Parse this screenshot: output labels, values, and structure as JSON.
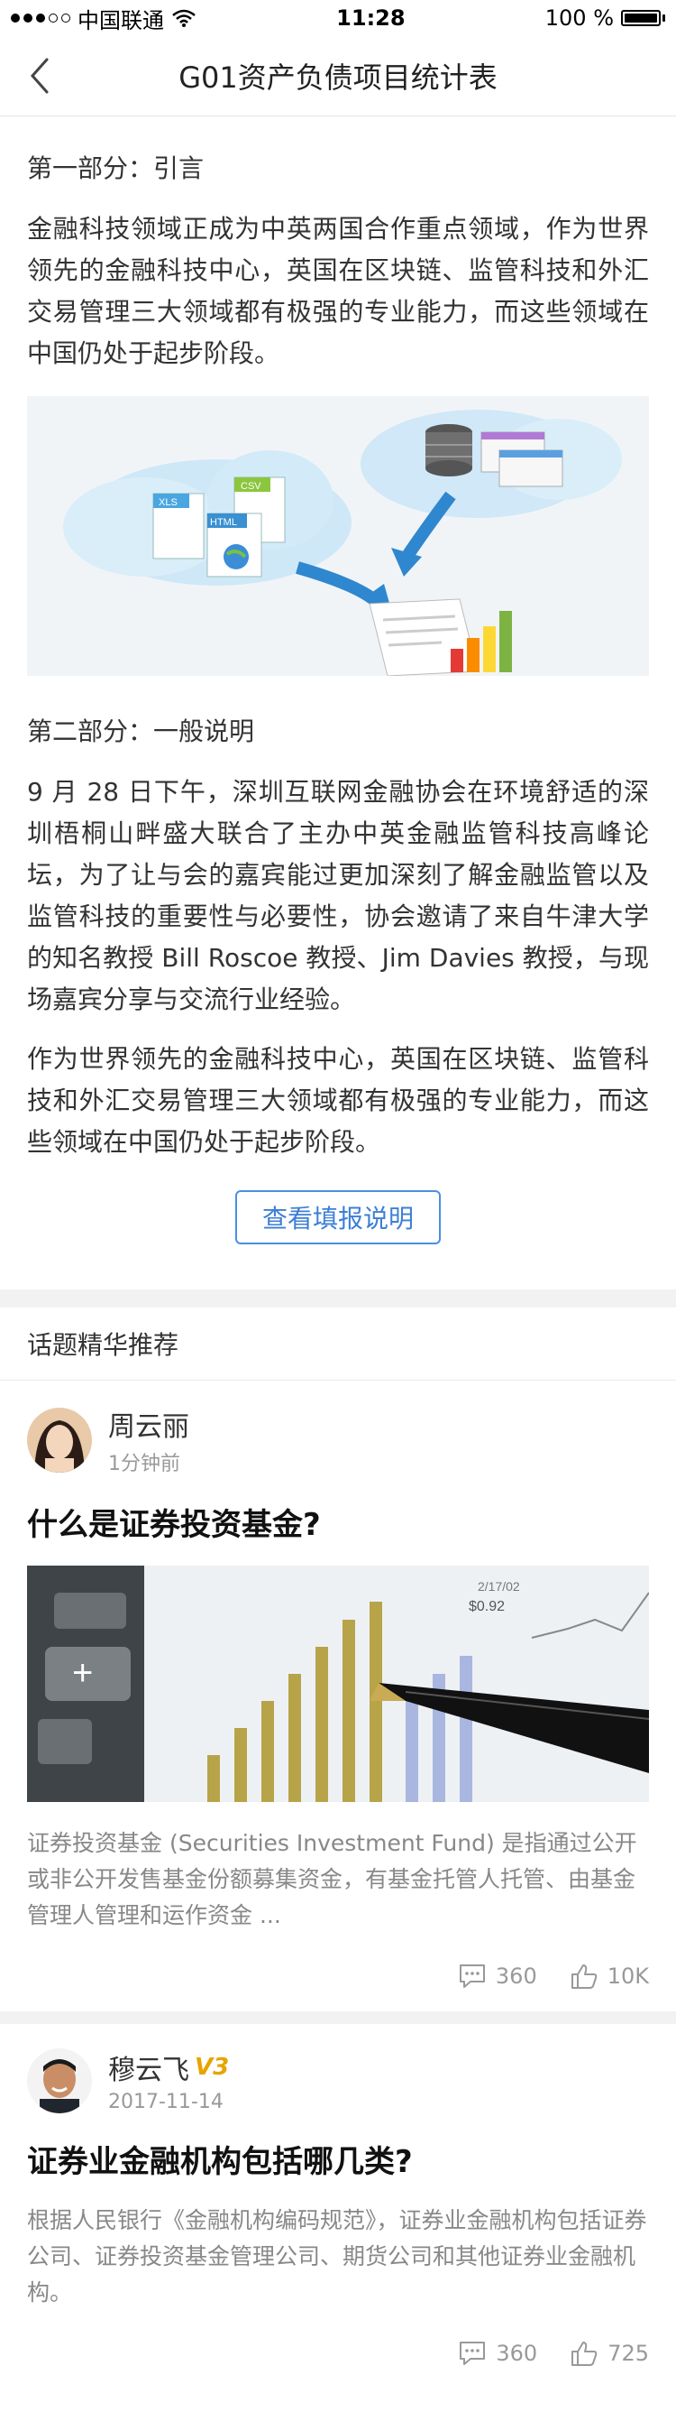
{
  "status": {
    "carrier": "中国联通",
    "time": "11:28",
    "battery": "100 %"
  },
  "nav": {
    "title": "G01资产负债项目统计表"
  },
  "intro": {
    "section1_title": "第一部分：引言",
    "para1": "金融科技领域正成为中英两国合作重点领域，作为世界领先的金融科技中心，英国在区块链、监管科技和外汇交易管理三大领域都有极强的专业能力，而这些领域在中国仍处于起步阶段。",
    "hero_labels": {
      "xls": "XLS",
      "csv": "CSV",
      "html": "HTML"
    },
    "section2_title": "第二部分：一般说明",
    "para2": "9 月 28 日下午，深圳互联网金融协会在环境舒适的深圳梧桐山畔盛大联合了主办中英金融监管科技高峰论坛，为了让与会的嘉宾能过更加深刻了解金融监管以及监管科技的重要性与必要性，协会邀请了来自牛津大学的知名教授 Bill Roscoe 教授、Jim Davies 教授，与现场嘉宾分享与交流行业经验。",
    "para3": "作为世界领先的金融科技中心，英国在区块链、监管科技和外汇交易管理三大领域都有极强的专业能力，而这些领域在中国仍处于起步阶段。",
    "button_label": "查看填报说明"
  },
  "recommend": {
    "header": "话题精华推荐",
    "posts": [
      {
        "author": "周云丽",
        "time": "1分钟前",
        "title": "什么是证券投资基金?",
        "image_texts": {
          "date": "2/17/02",
          "price": "$0.92"
        },
        "summary": "证券投资基金 (Securities Investment Fund) 是指通过公开或非公开发售基金份额募集资金，有基金托管人托管、由基金管理人管理和运作资金 ...",
        "comments": "360",
        "likes": "10K"
      },
      {
        "author": "穆云飞",
        "badge": "V3",
        "time": "2017-11-14",
        "title": "证券业金融机构包括哪几类?",
        "summary": "根据人民银行《金融机构编码规范》，证券业金融机构包括证券公司、证券投资基金管理公司、期货公司和其他证券业金融机构。",
        "comments": "360",
        "likes": "725"
      }
    ]
  }
}
